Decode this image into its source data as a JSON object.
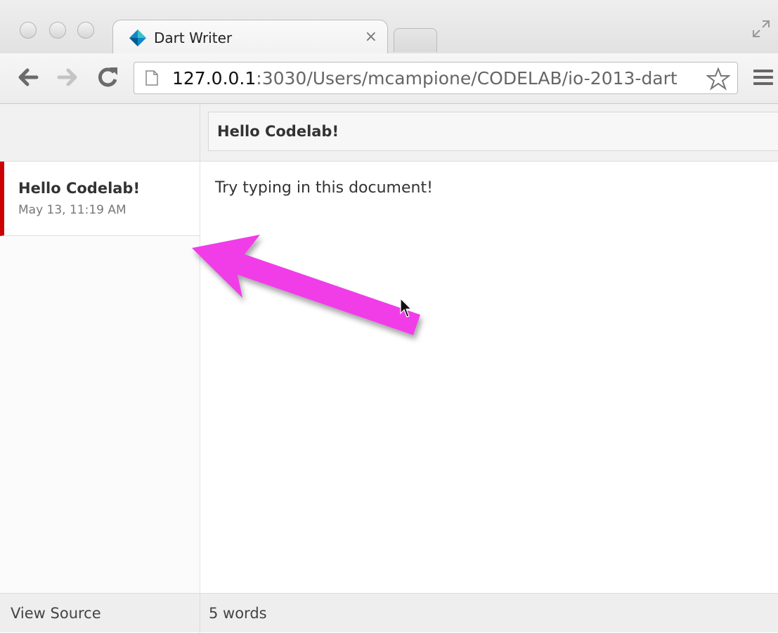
{
  "browser": {
    "tab": {
      "title": "Dart Writer",
      "close_glyph": "×",
      "favicon": "dart-logo-icon"
    },
    "address_bar": {
      "host": "127.0.0.1",
      "rest": ":3030/Users/mcampione/CODELAB/io-2013-dart"
    },
    "icons": [
      "back-icon",
      "forward-icon",
      "reload-icon",
      "page-icon",
      "star-icon",
      "menu-icon",
      "fullscreen-icon"
    ]
  },
  "app": {
    "title_value": "Hello Codelab!",
    "documents": [
      {
        "title": "Hello Codelab!",
        "date": "May 13, 11:19 AM",
        "selected": true
      }
    ],
    "editor_text": "Try typing in this document!",
    "footer": {
      "view_source": "View Source",
      "word_count": "5 words"
    }
  },
  "colors": {
    "selection_bar": "#cc0000",
    "annotation_arrow": "#f03ce8"
  }
}
